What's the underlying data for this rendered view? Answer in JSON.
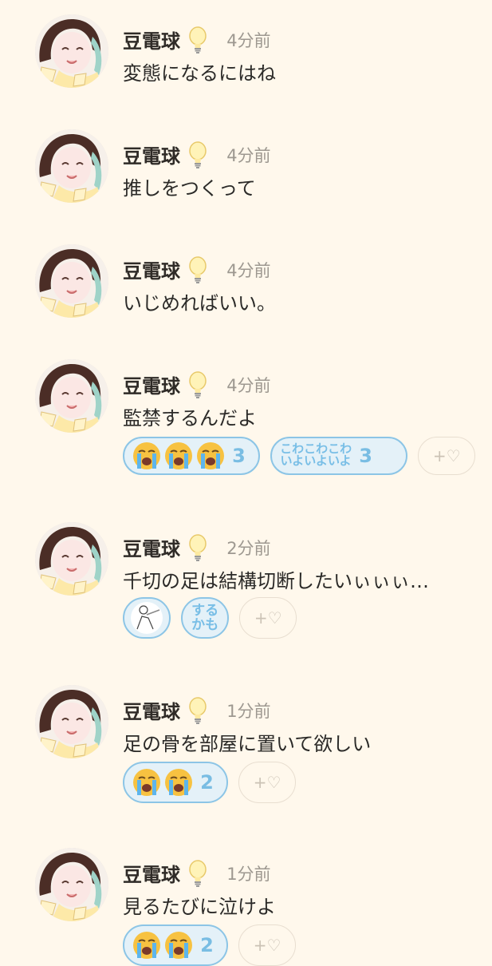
{
  "posts": [
    {
      "author": "豆電球",
      "time": "4分前",
      "text": "変態になるにはね",
      "reactions": []
    },
    {
      "author": "豆電球",
      "time": "4分前",
      "text": "推しをつくって",
      "reactions": []
    },
    {
      "author": "豆電球",
      "time": "4分前",
      "text": "いじめればいい。",
      "reactions": []
    },
    {
      "author": "豆電球",
      "time": "4分前",
      "text": "監禁するんだよ",
      "reactions": [
        {
          "icon": "loudly-crying-face-icon",
          "count": "3"
        },
        {
          "stamp_line1": "こわこわこわ",
          "stamp_line2": "いよいよいよ",
          "count": "3"
        }
      ]
    },
    {
      "author": "豆電球",
      "time": "2分前",
      "text": "千切の足は結構切断したいぃぃぃ…",
      "reactions": [
        {
          "icon": "sketch-stamp-icon"
        },
        {
          "stamp_line1": "する",
          "stamp_line2": "かも"
        }
      ]
    },
    {
      "author": "豆電球",
      "time": "1分前",
      "text": "足の骨を部屋に置いて欲しい",
      "reactions": [
        {
          "icon": "loudly-crying-face-icon",
          "count": "2"
        }
      ]
    },
    {
      "author": "豆電球",
      "time": "1分前",
      "text": "見るたびに泣けよ",
      "reactions": [
        {
          "icon": "loudly-crying-face-icon",
          "count": "2"
        }
      ]
    }
  ],
  "add_reaction_label": "+♡",
  "colors": {
    "background": "#fff8ec",
    "accent": "#8cc5e6",
    "count": "#79bde3",
    "time": "#9d9890"
  }
}
